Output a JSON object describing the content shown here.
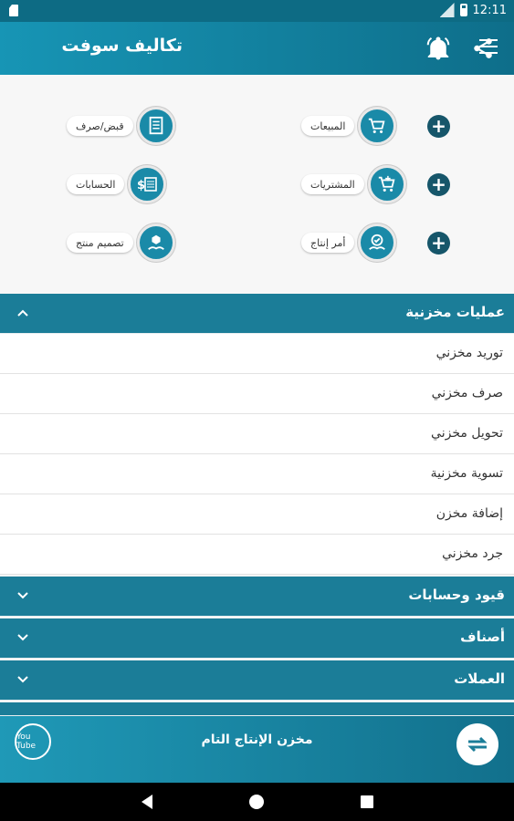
{
  "status_bar": {
    "time": "12:11"
  },
  "app_bar": {
    "title": "تكاليف سوفت"
  },
  "dashboard": {
    "tiles": [
      {
        "label": "المبيعات",
        "icon": "cart-icon"
      },
      {
        "label": "قبض/صرف",
        "icon": "receipt-icon"
      },
      {
        "label": "المشتريات",
        "icon": "cart-add-icon"
      },
      {
        "label": "الحسابات",
        "icon": "money-icon"
      },
      {
        "label": "أمر إنتاج",
        "icon": "production-icon"
      },
      {
        "label": "تصميم منتج",
        "icon": "product-design-icon"
      }
    ],
    "plus": "+"
  },
  "accordion": {
    "open_section": "عمليات مخزنية",
    "items": [
      "توريد مخزني",
      "صرف مخزني",
      "تحويل مخزني",
      "تسوية مخزنية",
      "إضافة مخزن",
      "جرد مخزني"
    ],
    "sections": [
      "قيود وحسابات",
      "أصناف",
      "العملات"
    ]
  },
  "banner": {
    "text": "مخزن الإنتاج التام",
    "youtube": "You Tube"
  },
  "colors": {
    "primary": "#1b7d98",
    "dark": "#0d6b84",
    "plus": "#16566a"
  }
}
